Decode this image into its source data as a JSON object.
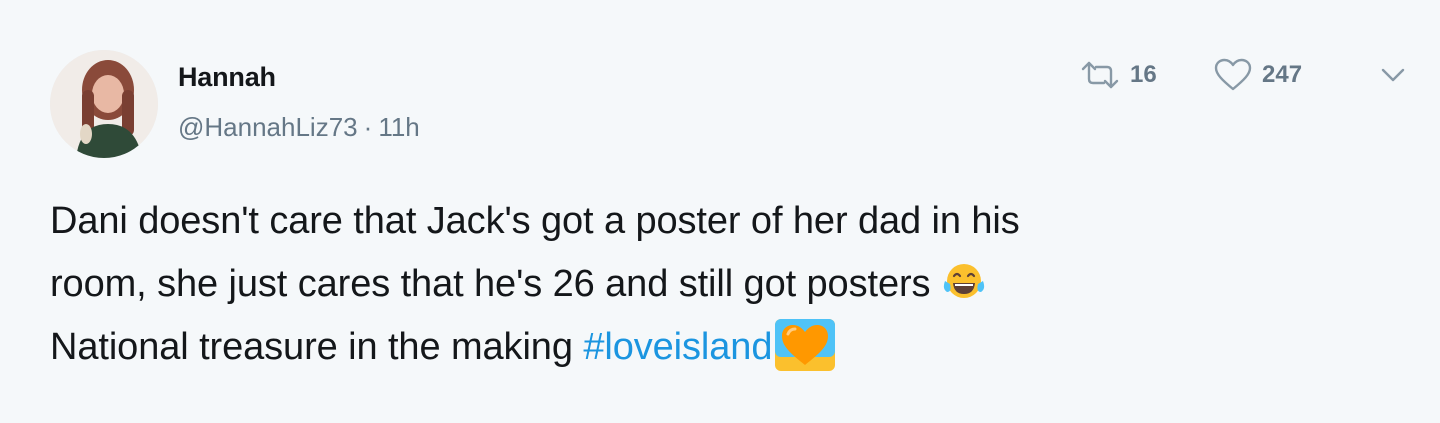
{
  "user": {
    "display_name": "Hannah",
    "handle": "@HannahLiz73",
    "separator": "·",
    "time": "11h"
  },
  "actions": {
    "retweet_count": "16",
    "like_count": "247"
  },
  "icons": {
    "retweet": "retweet-icon",
    "like": "heart-icon",
    "more": "chevron-down-icon",
    "emoji_1": "face-with-tears-of-joy-emoji",
    "emoji_2": "orange-heart-emoji"
  },
  "tweet": {
    "line1": "Dani doesn't care that Jack's got a poster of her dad in his",
    "line2": "room, she just cares that he's 26 and still got posters",
    "line3": "National treasure in the making",
    "hashtag": "#loveisland"
  },
  "colors": {
    "background": "#f5f8fa",
    "text": "#14171a",
    "secondary": "#657786",
    "link": "#1b95e0"
  }
}
